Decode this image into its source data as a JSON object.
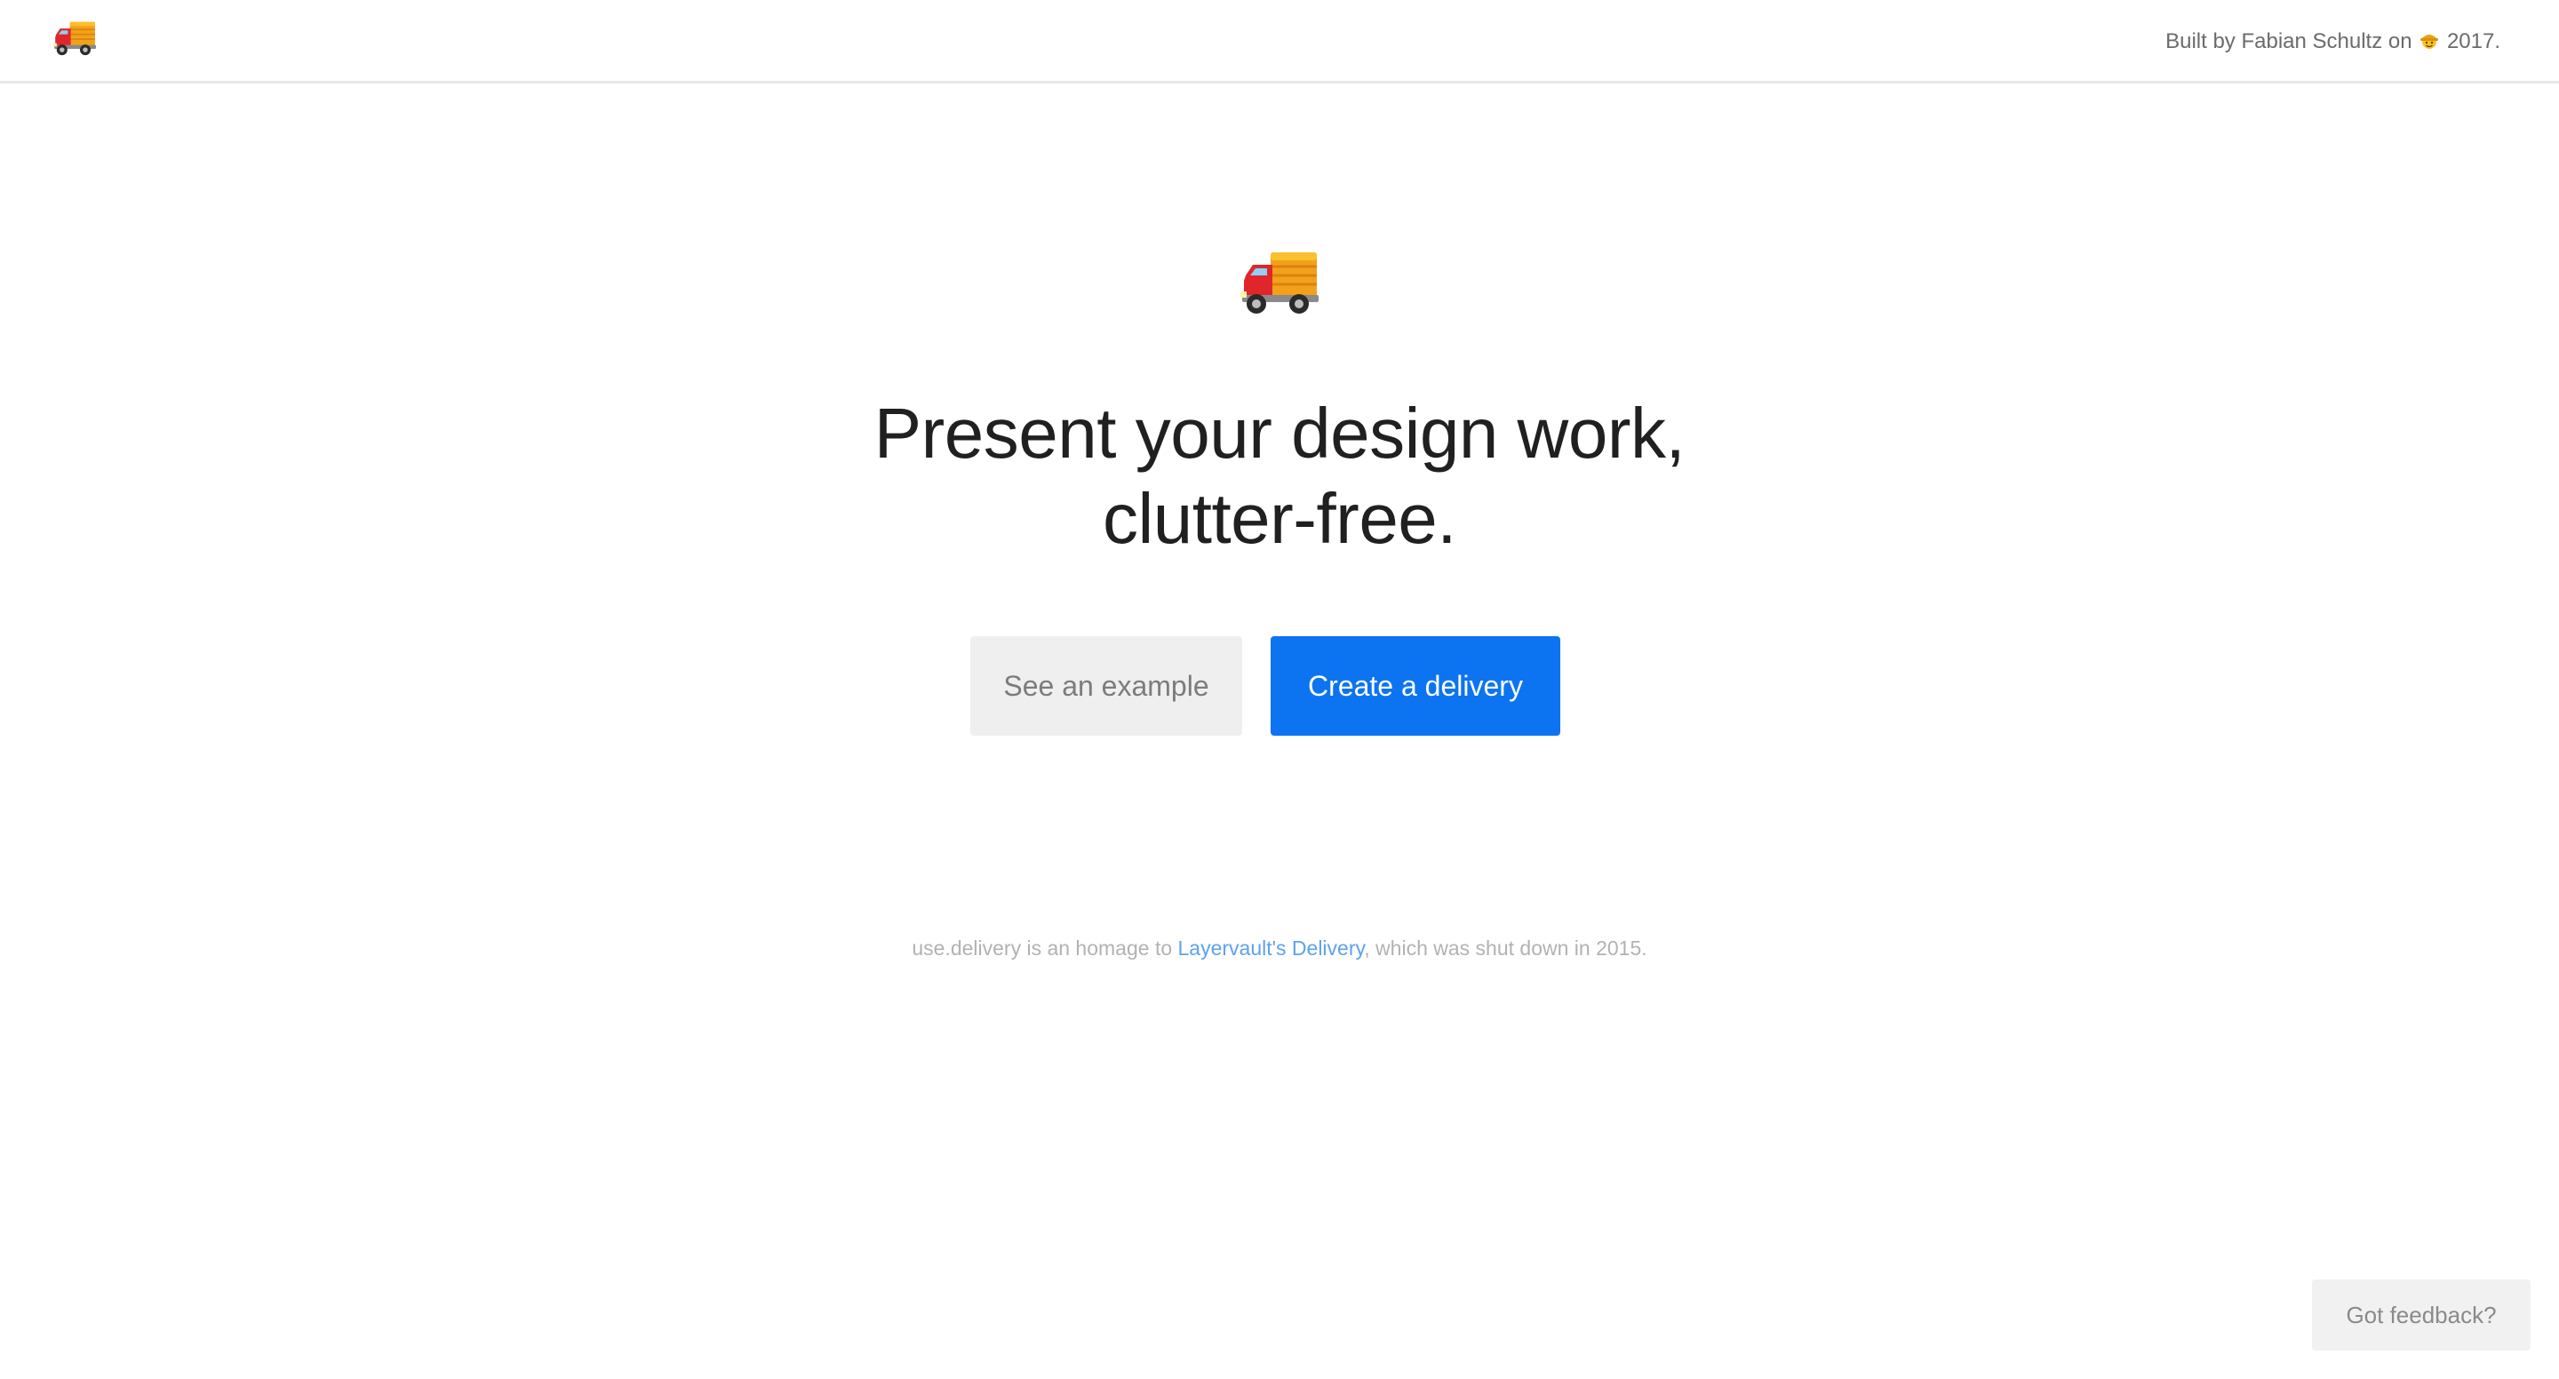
{
  "header": {
    "logo_icon": "delivery-truck-icon",
    "credit_prefix": "Built by Fabian Schultz on",
    "credit_icon": "smiling-sun-hat-icon",
    "credit_year": "2017."
  },
  "hero": {
    "icon": "delivery-truck-icon",
    "headline_line1": "Present your design work,",
    "headline_line2": "clutter-free.",
    "example_button": "See an example",
    "create_button": "Create a delivery"
  },
  "footer": {
    "homage_prefix": "use.delivery is an homage to",
    "homage_link": "Layervault's Delivery",
    "homage_suffix": ", which was shut down in 2015."
  },
  "feedback_button": "Got feedback?",
  "colors": {
    "primary": "#0d74f1",
    "link": "#5ea2ee",
    "secondary_button_bg": "#efefef",
    "headline_text": "#202020"
  }
}
